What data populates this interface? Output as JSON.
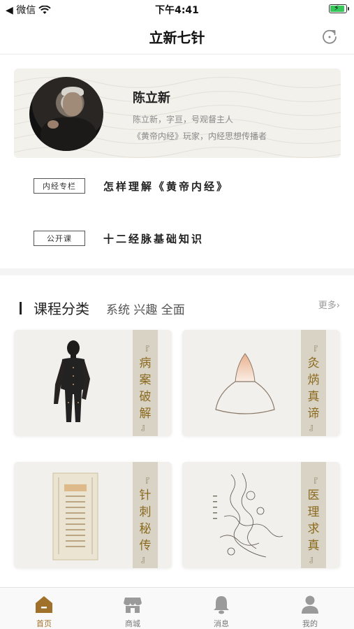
{
  "status_bar": {
    "carrier": "◀ 微信",
    "time": "下午4:41"
  },
  "nav": {
    "title": "立新七针",
    "refresh_icon": "refresh-icon"
  },
  "profile": {
    "name": "陈立新",
    "line1": "陈立新，字亘，号观督主人",
    "line2": "《黄帝内经》玩家，内经思想传播者"
  },
  "articles": [
    {
      "tag": "内经专栏",
      "title": "怎样理解《黄帝内经》"
    },
    {
      "tag": "公开课",
      "title": "十二经脉基础知识"
    }
  ],
  "section": {
    "title": "课程分类",
    "subtitle": "系统 兴趣 全面",
    "more": "更多"
  },
  "courses": [
    {
      "label": "病案破解",
      "open": "『",
      "close": "』"
    },
    {
      "label": "灸焫真谛",
      "open": "『",
      "close": "』"
    },
    {
      "label": "针刺秘传",
      "open": "『",
      "close": "』"
    },
    {
      "label": "医理求真",
      "open": "『",
      "close": "』"
    }
  ],
  "tabs": [
    {
      "label": "首页",
      "icon": "home-icon",
      "active": true
    },
    {
      "label": "商城",
      "icon": "shop-icon",
      "active": false
    },
    {
      "label": "消息",
      "icon": "bell-icon",
      "active": false
    },
    {
      "label": "我的",
      "icon": "user-icon",
      "active": false
    }
  ],
  "colors": {
    "accent": "#a0712a",
    "label_gold": "#8a6a1e",
    "strip": "#d9d3c5",
    "battery": "#35c759"
  }
}
